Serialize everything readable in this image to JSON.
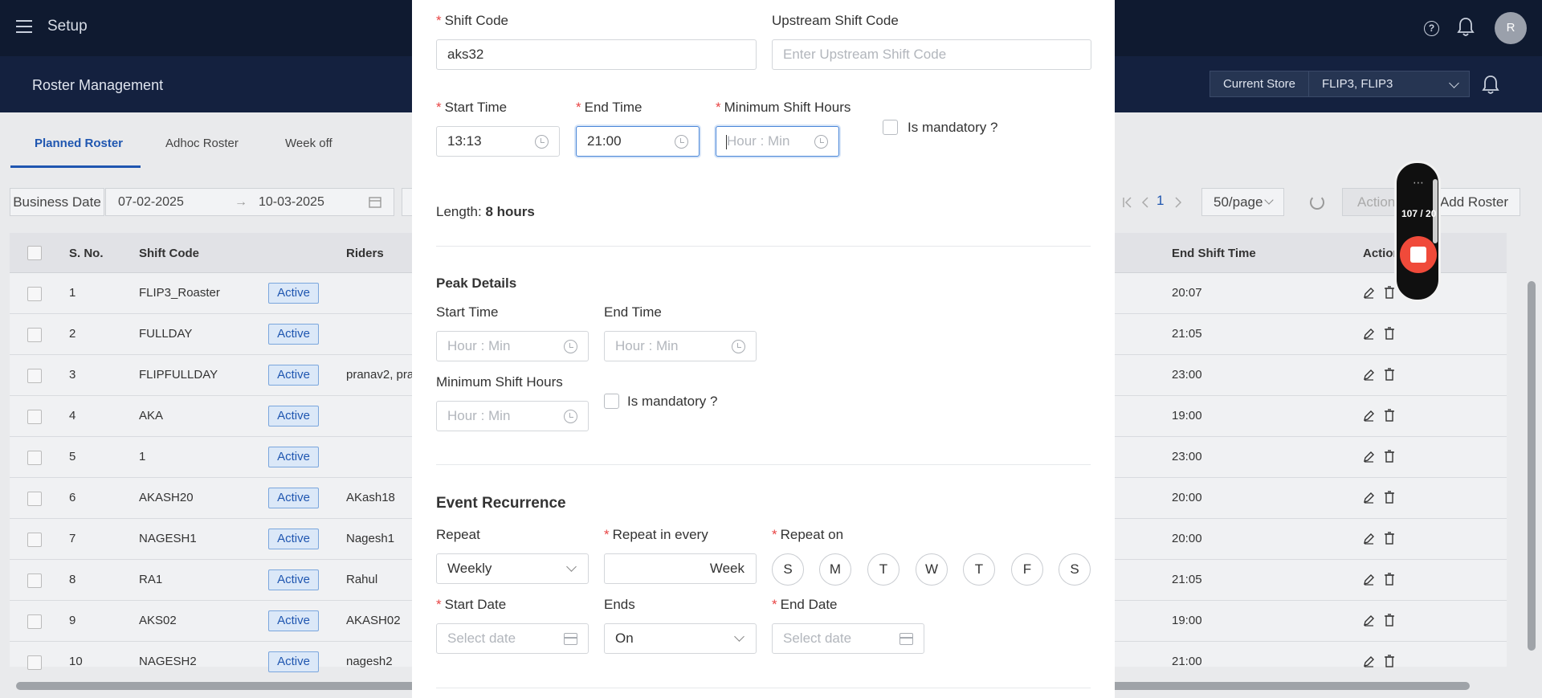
{
  "topbar": {
    "app_title": "Setup",
    "avatar_initial": "R",
    "help_glyph": "?"
  },
  "subbar": {
    "page_title": "Roster Management",
    "store_label": "Current Store",
    "store_value": "FLIP3, FLIP3"
  },
  "tabs": [
    {
      "label": "Planned Roster",
      "active": true
    },
    {
      "label": "Adhoc Roster",
      "active": false
    },
    {
      "label": "Week off",
      "active": false
    }
  ],
  "filters": {
    "label": "Business Date",
    "from": "07-02-2025",
    "arrow": "→",
    "to": "10-03-2025"
  },
  "pager": {
    "current": "1",
    "page_size": "50/page",
    "actions": "Actions",
    "add": "Add Roster"
  },
  "table": {
    "headers": {
      "sno": "S. No.",
      "shift_code": "Shift Code",
      "riders": "Riders",
      "end_shift": "End Shift Time",
      "action": "Action"
    },
    "rows": [
      {
        "sno": "1",
        "code": "FLIP3_Roaster",
        "status": "Active",
        "riders": "",
        "end": "20:07"
      },
      {
        "sno": "2",
        "code": "FULLDAY",
        "status": "Active",
        "riders": "",
        "end": "21:05"
      },
      {
        "sno": "3",
        "code": "FLIPFULLDAY",
        "status": "Active",
        "riders": "pranav2, pra",
        "end": "23:00"
      },
      {
        "sno": "4",
        "code": "AKA",
        "status": "Active",
        "riders": "",
        "end": "19:00"
      },
      {
        "sno": "5",
        "code": "1",
        "status": "Active",
        "riders": "",
        "end": "23:00"
      },
      {
        "sno": "6",
        "code": "AKASH20",
        "status": "Active",
        "riders": "AKash18",
        "end": "20:00"
      },
      {
        "sno": "7",
        "code": "NAGESH1",
        "status": "Active",
        "riders": "Nagesh1",
        "end": "20:00"
      },
      {
        "sno": "8",
        "code": "RA1",
        "status": "Active",
        "riders": "Rahul",
        "end": "21:05"
      },
      {
        "sno": "9",
        "code": "AKS02",
        "status": "Active",
        "riders": "AKASH02",
        "end": "19:00"
      },
      {
        "sno": "10",
        "code": "NAGESH2",
        "status": "Active",
        "riders": "nagesh2",
        "end": "21:00"
      }
    ]
  },
  "recorder": {
    "count": "107 / 20",
    "grip": "⋯"
  },
  "modal": {
    "shift_code": {
      "label": "Shift Code",
      "value": "aks32"
    },
    "upstream": {
      "label": "Upstream Shift Code",
      "placeholder": "Enter Upstream Shift Code"
    },
    "start_time": {
      "label": "Start Time",
      "value": "13:13"
    },
    "end_time": {
      "label": "End Time",
      "value": "21:00"
    },
    "min_hours": {
      "label": "Minimum Shift Hours",
      "placeholder": "Hour : Min"
    },
    "mandatory": "Is mandatory ?",
    "length_label": "Length:",
    "length_value": "8 hours",
    "peak": {
      "title": "Peak Details",
      "start_label": "Start Time",
      "end_label": "End Time",
      "min_label": "Minimum Shift Hours",
      "placeholder": "Hour : Min",
      "mandatory": "Is mandatory ?"
    },
    "recurrence": {
      "title": "Event Recurrence",
      "repeat_label": "Repeat",
      "repeat_value": "Weekly",
      "every_label": "Repeat in every",
      "every_unit": "Week",
      "on_label": "Repeat on",
      "days": [
        "S",
        "M",
        "T",
        "W",
        "T",
        "F",
        "S"
      ],
      "start_date_label": "Start Date",
      "date_placeholder": "Select date",
      "ends_label": "Ends",
      "ends_value": "On",
      "end_date_label": "End Date"
    },
    "required_mark": "*"
  }
}
